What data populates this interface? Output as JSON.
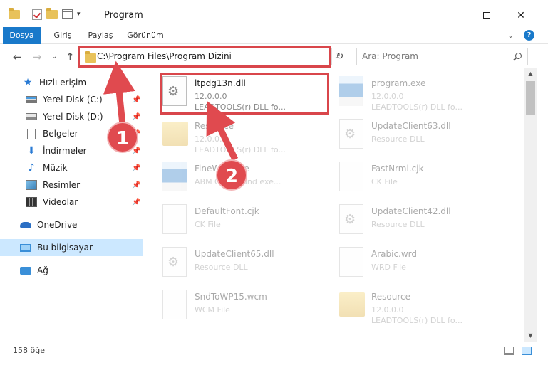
{
  "window": {
    "title": "Program"
  },
  "ribbon": {
    "tabs": [
      "Dosya",
      "Giriş",
      "Paylaş",
      "Görünüm"
    ]
  },
  "nav": {
    "address": "C:\\Program Files\\Program Dizini",
    "search_placeholder": "Ara: Program"
  },
  "sidebar": {
    "items": [
      {
        "label": "Hızlı erişim",
        "icon": "star-icon"
      },
      {
        "label": "Yerel Disk (C:)",
        "icon": "drive-icon"
      },
      {
        "label": "Yerel Disk (D:)",
        "icon": "drive-icon"
      },
      {
        "label": "Belgeler",
        "icon": "documents-icon"
      },
      {
        "label": "İndirmeler",
        "icon": "downloads-icon"
      },
      {
        "label": "Müzik",
        "icon": "music-icon"
      },
      {
        "label": "Resimler",
        "icon": "pictures-icon"
      },
      {
        "label": "Videolar",
        "icon": "videos-icon"
      },
      {
        "label": "OneDrive",
        "icon": "cloud-icon"
      },
      {
        "label": "Bu bilgisayar",
        "icon": "computer-icon"
      },
      {
        "label": "Ağ",
        "icon": "network-icon"
      }
    ]
  },
  "files": [
    {
      "name": "ltpdg13n.dll",
      "line1": "12.0.0.0",
      "line2": "LEADTOOLS(r) DLL fo...",
      "icon": "dll-gear-icon"
    },
    {
      "name": "program.exe",
      "line1": "12.0.0.0",
      "line2": "LEADTOOLS(r) DLL fo...",
      "icon": "application-icon"
    },
    {
      "name": "Resource",
      "line1": "12.0.0.0",
      "line2": "LEADTOOLS(r) DLL fo...",
      "icon": "folder-icon"
    },
    {
      "name": "UpdateClient63.dll",
      "line1": "Resource DLL",
      "line2": "",
      "icon": "dll-gear-icon"
    },
    {
      "name": "FineWalkerre",
      "line1": "ABM Compound exe...",
      "line2": "",
      "icon": "application-icon"
    },
    {
      "name": "FastNrml.cjk",
      "line1": "CK File",
      "line2": "",
      "icon": "file-icon"
    },
    {
      "name": "DefaultFont.cjk",
      "line1": "CK File",
      "line2": "",
      "icon": "file-icon"
    },
    {
      "name": "UpdateClient42.dll",
      "line1": "Resource DLL",
      "line2": "",
      "icon": "dll-gear-icon"
    },
    {
      "name": "UpdateClient65.dll",
      "line1": "Resource DLL",
      "line2": "",
      "icon": "dll-gear-icon"
    },
    {
      "name": "Arabic.wrd",
      "line1": "WRD File",
      "line2": "",
      "icon": "file-icon"
    },
    {
      "name": "SndToWP15.wcm",
      "line1": "WCM File",
      "line2": "",
      "icon": "file-icon"
    },
    {
      "name": "Resource",
      "line1": "12.0.0.0",
      "line2": "LEADTOOLS(r) DLL fo...",
      "icon": "folder-icon"
    }
  ],
  "callouts": [
    "1",
    "2"
  ],
  "status": {
    "count": "158 öğe"
  },
  "colors": {
    "accent": "#1979ca",
    "annotation": "#d9464b",
    "selection": "#cce8ff"
  }
}
